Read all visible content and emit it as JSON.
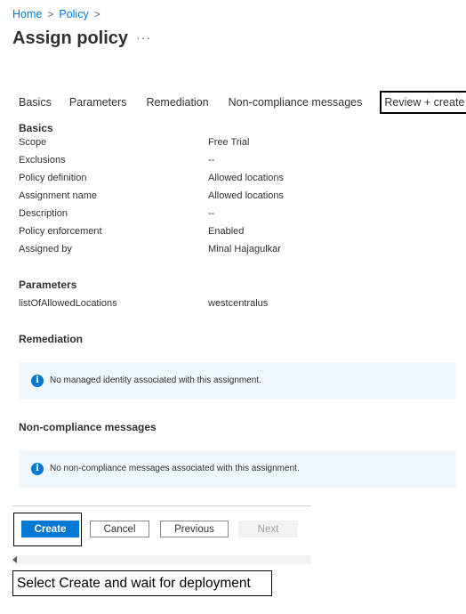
{
  "breadcrumb": {
    "items": [
      "Home",
      "Policy"
    ],
    "separator": ">"
  },
  "page": {
    "title": "Assign policy",
    "more_label": "···"
  },
  "tabs": [
    {
      "label": "Basics"
    },
    {
      "label": "Parameters"
    },
    {
      "label": "Remediation"
    },
    {
      "label": "Non-compliance messages"
    },
    {
      "label": "Review + create",
      "active": true
    }
  ],
  "basics": {
    "heading": "Basics",
    "rows": [
      {
        "label": "Scope",
        "value": "Free Trial"
      },
      {
        "label": "Exclusions",
        "value": "--"
      },
      {
        "label": "Policy definition",
        "value": "Allowed locations"
      },
      {
        "label": "Assignment name",
        "value": "Allowed locations"
      },
      {
        "label": "Description",
        "value": "--"
      },
      {
        "label": "Policy enforcement",
        "value": "Enabled"
      },
      {
        "label": "Assigned by",
        "value": "Minal Hajagulkar"
      }
    ]
  },
  "parameters": {
    "heading": "Parameters",
    "rows": [
      {
        "label": "listOfAllowedLocations",
        "value": "westcentralus"
      }
    ]
  },
  "remediation": {
    "heading": "Remediation",
    "info": "No managed identity associated with this assignment."
  },
  "noncompliance": {
    "heading": "Non-compliance messages",
    "info": "No non-compliance messages associated with this assignment."
  },
  "footer": {
    "create_label": "Create",
    "cancel_label": "Cancel",
    "previous_label": "Previous",
    "next_label": "Next"
  },
  "caption": "Select Create and wait for deployment",
  "colors": {
    "accent": "#0078d4",
    "info_bg": "#eff6fc"
  }
}
